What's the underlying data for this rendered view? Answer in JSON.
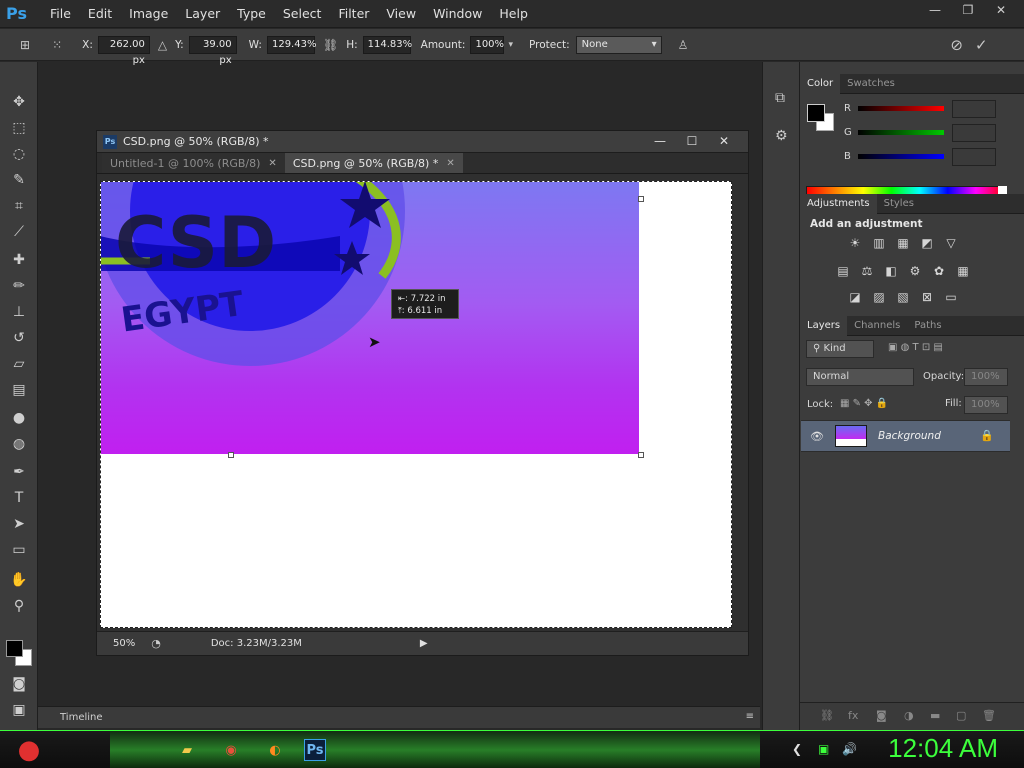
{
  "app": {
    "logo": "Ps"
  },
  "menu": [
    "File",
    "Edit",
    "Image",
    "Layer",
    "Type",
    "Select",
    "Filter",
    "View",
    "Window",
    "Help"
  ],
  "window_controls": [
    "minimize-icon",
    "restore-icon",
    "close-icon"
  ],
  "options": {
    "x_label": "X:",
    "x_value": "262.00 px",
    "y_label": "Y:",
    "y_value": "39.00 px",
    "w_label": "W:",
    "w_value": "129.43%",
    "h_label": "H:",
    "h_value": "114.83%",
    "amount_label": "Amount:",
    "amount_value": "100%",
    "protect_label": "Protect:",
    "protect_value": "None"
  },
  "document": {
    "title": "CSD.png @ 50% (RGB/8) *",
    "tabs": [
      {
        "label": "Untitled-1 @ 100% (RGB/8)",
        "active": false
      },
      {
        "label": "CSD.png @ 50% (RGB/8) *",
        "active": true
      }
    ],
    "hud": {
      "width": "7.722 in",
      "height": "6.611 in"
    },
    "zoom": "50%",
    "doc_size": "Doc: 3.23M/3.23M",
    "image_text": "EGYPT"
  },
  "timeline": {
    "label": "Timeline"
  },
  "panels": {
    "color_tabs": [
      "Color",
      "Swatches"
    ],
    "channels": [
      {
        "label": "R",
        "color": "#ff0000"
      },
      {
        "label": "G",
        "color": "#00c800"
      },
      {
        "label": "B",
        "color": "#0000ff"
      }
    ],
    "adjust_tabs": [
      "Adjustments",
      "Styles"
    ],
    "add_adjustment": "Add an adjustment",
    "layers_tabs": [
      "Layers",
      "Channels",
      "Paths"
    ],
    "kind": "Kind",
    "blend_mode": "Normal",
    "opacity_label": "Opacity:",
    "opacity_value": "100%",
    "lock_label": "Lock:",
    "fill_label": "Fill:",
    "fill_value": "100%",
    "layer_name": "Background"
  },
  "taskbar": {
    "clock": "12:04 AM",
    "ps_label": "Ps"
  }
}
